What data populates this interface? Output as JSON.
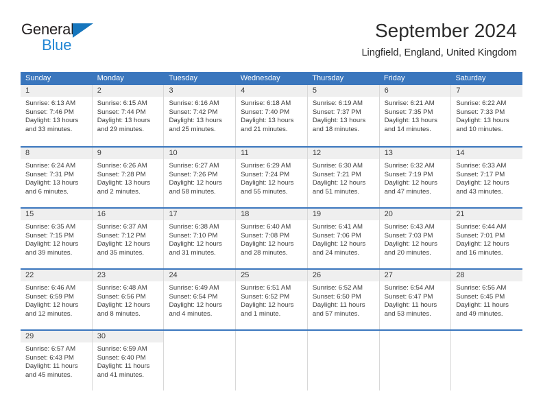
{
  "brand": {
    "name_top": "General",
    "name_bottom": "Blue",
    "accent_color": "#2387d4",
    "triangle_color": "#1676bd"
  },
  "header": {
    "title": "September 2024",
    "subtitle": "Lingfield, England, United Kingdom"
  },
  "theme": {
    "header_blue": "#3a76bd",
    "daynum_band": "#efefef",
    "cell_border": "#d8d8d8",
    "text": "#3b3b3b"
  },
  "calendar": {
    "weekday_headers": [
      "Sunday",
      "Monday",
      "Tuesday",
      "Wednesday",
      "Thursday",
      "Friday",
      "Saturday"
    ],
    "weeks": [
      [
        {
          "day": "1",
          "sunrise": "Sunrise: 6:13 AM",
          "sunset": "Sunset: 7:46 PM",
          "daylight_1": "Daylight: 13 hours",
          "daylight_2": "and 33 minutes."
        },
        {
          "day": "2",
          "sunrise": "Sunrise: 6:15 AM",
          "sunset": "Sunset: 7:44 PM",
          "daylight_1": "Daylight: 13 hours",
          "daylight_2": "and 29 minutes."
        },
        {
          "day": "3",
          "sunrise": "Sunrise: 6:16 AM",
          "sunset": "Sunset: 7:42 PM",
          "daylight_1": "Daylight: 13 hours",
          "daylight_2": "and 25 minutes."
        },
        {
          "day": "4",
          "sunrise": "Sunrise: 6:18 AM",
          "sunset": "Sunset: 7:40 PM",
          "daylight_1": "Daylight: 13 hours",
          "daylight_2": "and 21 minutes."
        },
        {
          "day": "5",
          "sunrise": "Sunrise: 6:19 AM",
          "sunset": "Sunset: 7:37 PM",
          "daylight_1": "Daylight: 13 hours",
          "daylight_2": "and 18 minutes."
        },
        {
          "day": "6",
          "sunrise": "Sunrise: 6:21 AM",
          "sunset": "Sunset: 7:35 PM",
          "daylight_1": "Daylight: 13 hours",
          "daylight_2": "and 14 minutes."
        },
        {
          "day": "7",
          "sunrise": "Sunrise: 6:22 AM",
          "sunset": "Sunset: 7:33 PM",
          "daylight_1": "Daylight: 13 hours",
          "daylight_2": "and 10 minutes."
        }
      ],
      [
        {
          "day": "8",
          "sunrise": "Sunrise: 6:24 AM",
          "sunset": "Sunset: 7:31 PM",
          "daylight_1": "Daylight: 13 hours",
          "daylight_2": "and 6 minutes."
        },
        {
          "day": "9",
          "sunrise": "Sunrise: 6:26 AM",
          "sunset": "Sunset: 7:28 PM",
          "daylight_1": "Daylight: 13 hours",
          "daylight_2": "and 2 minutes."
        },
        {
          "day": "10",
          "sunrise": "Sunrise: 6:27 AM",
          "sunset": "Sunset: 7:26 PM",
          "daylight_1": "Daylight: 12 hours",
          "daylight_2": "and 58 minutes."
        },
        {
          "day": "11",
          "sunrise": "Sunrise: 6:29 AM",
          "sunset": "Sunset: 7:24 PM",
          "daylight_1": "Daylight: 12 hours",
          "daylight_2": "and 55 minutes."
        },
        {
          "day": "12",
          "sunrise": "Sunrise: 6:30 AM",
          "sunset": "Sunset: 7:21 PM",
          "daylight_1": "Daylight: 12 hours",
          "daylight_2": "and 51 minutes."
        },
        {
          "day": "13",
          "sunrise": "Sunrise: 6:32 AM",
          "sunset": "Sunset: 7:19 PM",
          "daylight_1": "Daylight: 12 hours",
          "daylight_2": "and 47 minutes."
        },
        {
          "day": "14",
          "sunrise": "Sunrise: 6:33 AM",
          "sunset": "Sunset: 7:17 PM",
          "daylight_1": "Daylight: 12 hours",
          "daylight_2": "and 43 minutes."
        }
      ],
      [
        {
          "day": "15",
          "sunrise": "Sunrise: 6:35 AM",
          "sunset": "Sunset: 7:15 PM",
          "daylight_1": "Daylight: 12 hours",
          "daylight_2": "and 39 minutes."
        },
        {
          "day": "16",
          "sunrise": "Sunrise: 6:37 AM",
          "sunset": "Sunset: 7:12 PM",
          "daylight_1": "Daylight: 12 hours",
          "daylight_2": "and 35 minutes."
        },
        {
          "day": "17",
          "sunrise": "Sunrise: 6:38 AM",
          "sunset": "Sunset: 7:10 PM",
          "daylight_1": "Daylight: 12 hours",
          "daylight_2": "and 31 minutes."
        },
        {
          "day": "18",
          "sunrise": "Sunrise: 6:40 AM",
          "sunset": "Sunset: 7:08 PM",
          "daylight_1": "Daylight: 12 hours",
          "daylight_2": "and 28 minutes."
        },
        {
          "day": "19",
          "sunrise": "Sunrise: 6:41 AM",
          "sunset": "Sunset: 7:06 PM",
          "daylight_1": "Daylight: 12 hours",
          "daylight_2": "and 24 minutes."
        },
        {
          "day": "20",
          "sunrise": "Sunrise: 6:43 AM",
          "sunset": "Sunset: 7:03 PM",
          "daylight_1": "Daylight: 12 hours",
          "daylight_2": "and 20 minutes."
        },
        {
          "day": "21",
          "sunrise": "Sunrise: 6:44 AM",
          "sunset": "Sunset: 7:01 PM",
          "daylight_1": "Daylight: 12 hours",
          "daylight_2": "and 16 minutes."
        }
      ],
      [
        {
          "day": "22",
          "sunrise": "Sunrise: 6:46 AM",
          "sunset": "Sunset: 6:59 PM",
          "daylight_1": "Daylight: 12 hours",
          "daylight_2": "and 12 minutes."
        },
        {
          "day": "23",
          "sunrise": "Sunrise: 6:48 AM",
          "sunset": "Sunset: 6:56 PM",
          "daylight_1": "Daylight: 12 hours",
          "daylight_2": "and 8 minutes."
        },
        {
          "day": "24",
          "sunrise": "Sunrise: 6:49 AM",
          "sunset": "Sunset: 6:54 PM",
          "daylight_1": "Daylight: 12 hours",
          "daylight_2": "and 4 minutes."
        },
        {
          "day": "25",
          "sunrise": "Sunrise: 6:51 AM",
          "sunset": "Sunset: 6:52 PM",
          "daylight_1": "Daylight: 12 hours",
          "daylight_2": "and 1 minute."
        },
        {
          "day": "26",
          "sunrise": "Sunrise: 6:52 AM",
          "sunset": "Sunset: 6:50 PM",
          "daylight_1": "Daylight: 11 hours",
          "daylight_2": "and 57 minutes."
        },
        {
          "day": "27",
          "sunrise": "Sunrise: 6:54 AM",
          "sunset": "Sunset: 6:47 PM",
          "daylight_1": "Daylight: 11 hours",
          "daylight_2": "and 53 minutes."
        },
        {
          "day": "28",
          "sunrise": "Sunrise: 6:56 AM",
          "sunset": "Sunset: 6:45 PM",
          "daylight_1": "Daylight: 11 hours",
          "daylight_2": "and 49 minutes."
        }
      ],
      [
        {
          "day": "29",
          "sunrise": "Sunrise: 6:57 AM",
          "sunset": "Sunset: 6:43 PM",
          "daylight_1": "Daylight: 11 hours",
          "daylight_2": "and 45 minutes."
        },
        {
          "day": "30",
          "sunrise": "Sunrise: 6:59 AM",
          "sunset": "Sunset: 6:40 PM",
          "daylight_1": "Daylight: 11 hours",
          "daylight_2": "and 41 minutes."
        },
        {
          "day": "",
          "sunrise": "",
          "sunset": "",
          "daylight_1": "",
          "daylight_2": ""
        },
        {
          "day": "",
          "sunrise": "",
          "sunset": "",
          "daylight_1": "",
          "daylight_2": ""
        },
        {
          "day": "",
          "sunrise": "",
          "sunset": "",
          "daylight_1": "",
          "daylight_2": ""
        },
        {
          "day": "",
          "sunrise": "",
          "sunset": "",
          "daylight_1": "",
          "daylight_2": ""
        },
        {
          "day": "",
          "sunrise": "",
          "sunset": "",
          "daylight_1": "",
          "daylight_2": ""
        }
      ]
    ]
  }
}
